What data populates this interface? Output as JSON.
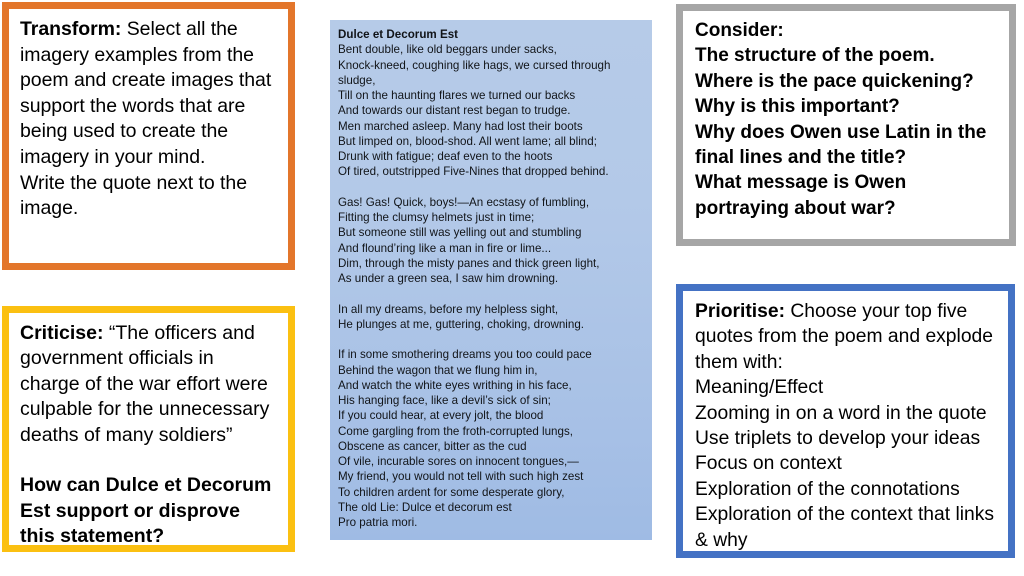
{
  "slide": {
    "colors": {
      "transform_border": "#E3762B",
      "criticise_border": "#FBC011",
      "consider_border": "#A6A6A6",
      "prioritise_border": "#4472C4",
      "poem_background": "#B3C9E8"
    }
  },
  "transform": {
    "lead": "Transform:",
    "body": " Select all the imagery examples from the poem and create images that support the words that are being used to create the imagery in your mind.",
    "body_line2": "Write the quote next to the image."
  },
  "criticise": {
    "lead": "Criticise:",
    "quote": " “The officers and government officials in charge of the war effort were culpable for the unnecessary deaths of many soldiers”",
    "question": "How can Dulce et Decorum Est support or disprove this statement?"
  },
  "consider": {
    "heading": "Consider:",
    "questions": [
      "The structure of the poem.",
      "Where is the pace quickening?",
      "Why is this important?",
      "Why does Owen use Latin in the final lines and the title?",
      "What message is Owen portraying about war?"
    ]
  },
  "prioritise": {
    "lead": "Prioritise:",
    "intro": " Choose your top five quotes from the poem and explode them with:",
    "items": [
      "Meaning/Effect",
      "Zooming in on a word in the quote",
      "Use triplets to develop your ideas",
      "Focus on context",
      "Exploration of the connotations",
      "Exploration of the context that links & why"
    ]
  },
  "poem": {
    "title": "Dulce et Decorum Est",
    "lines": [
      "Bent double, like old beggars under sacks,",
      "Knock-kneed, coughing like hags, we cursed through",
      "sludge,",
      "Till on the haunting flares we turned our backs",
      "And towards our distant rest began to trudge.",
      "Men marched asleep. Many had lost their boots",
      "But limped on, blood-shod. All went lame; all blind;",
      "Drunk with fatigue; deaf even to the hoots",
      "Of tired, outstripped Five-Nines that dropped behind.",
      "",
      "Gas! Gas! Quick, boys!—An ecstasy of fumbling,",
      "Fitting the clumsy helmets just in time;",
      "But someone still was yelling out and stumbling",
      "And flound’ring like a man in fire or lime...",
      "Dim, through the misty panes and thick green light,",
      "As under a green sea, I saw him drowning.",
      "",
      "In all my dreams, before my helpless sight,",
      "He plunges at me, guttering, choking, drowning.",
      "",
      "If in some smothering dreams you too could pace",
      "Behind the wagon that we flung him in,",
      "And watch the white eyes writhing in his face,",
      "His hanging face, like a devil’s sick of sin;",
      "If you could hear, at every jolt, the blood",
      "Come gargling from the froth-corrupted lungs,",
      "Obscene as cancer, bitter as the cud",
      "Of vile, incurable sores on innocent tongues,—",
      "My friend, you would not tell with such high zest",
      "To children ardent for some desperate glory,",
      "The old Lie: Dulce et decorum est",
      "Pro patria mori."
    ]
  }
}
